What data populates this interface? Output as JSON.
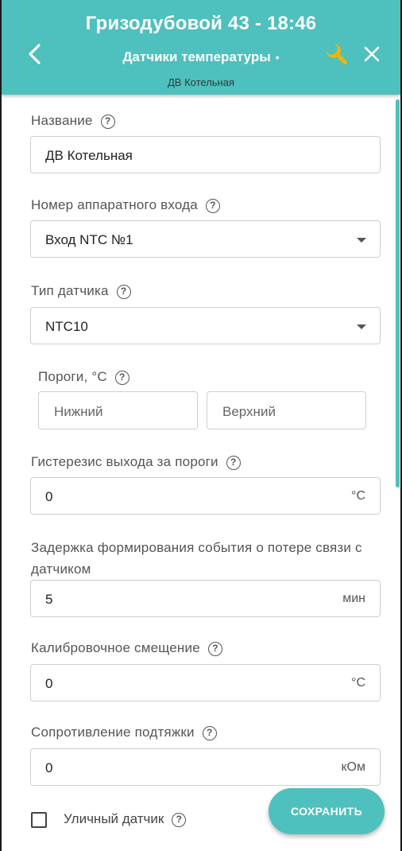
{
  "header": {
    "title": "Гризодубовой 43 - 18:46",
    "subtitle": "Датчики температуры",
    "subtitle_dot": "•",
    "device": "ДВ Котельная",
    "color": "#4ec0bd"
  },
  "form": {
    "name": {
      "label": "Название",
      "value": "ДВ Котельная"
    },
    "hw_input": {
      "label": "Номер аппаратного входа",
      "value": "Вход NTC №1"
    },
    "sensor_type": {
      "label": "Тип датчика",
      "value": "NTC10"
    },
    "thresholds": {
      "label": "Пороги, °C",
      "lower_placeholder": "Нижний",
      "upper_placeholder": "Верхний"
    },
    "hysteresis": {
      "label": "Гистерезис выхода за пороги",
      "value": "0",
      "unit": "°C"
    },
    "delay": {
      "label": "Задержка формирования события о потере связи с датчиком",
      "value": "5",
      "unit": "мин"
    },
    "calibration": {
      "label": "Калибровочное смещение",
      "value": "0",
      "unit": "°C"
    },
    "pullup": {
      "label": "Сопротивление подтяжки",
      "value": "0",
      "unit": "кОм"
    },
    "outdoor": {
      "label": "Уличный датчик",
      "checked": false
    }
  },
  "help_glyph": "?",
  "save_label": "СОХРАНИТЬ",
  "icons": [
    "back-arrow-icon",
    "wrench-icon",
    "close-icon",
    "help-icon",
    "dropdown-caret-icon"
  ]
}
